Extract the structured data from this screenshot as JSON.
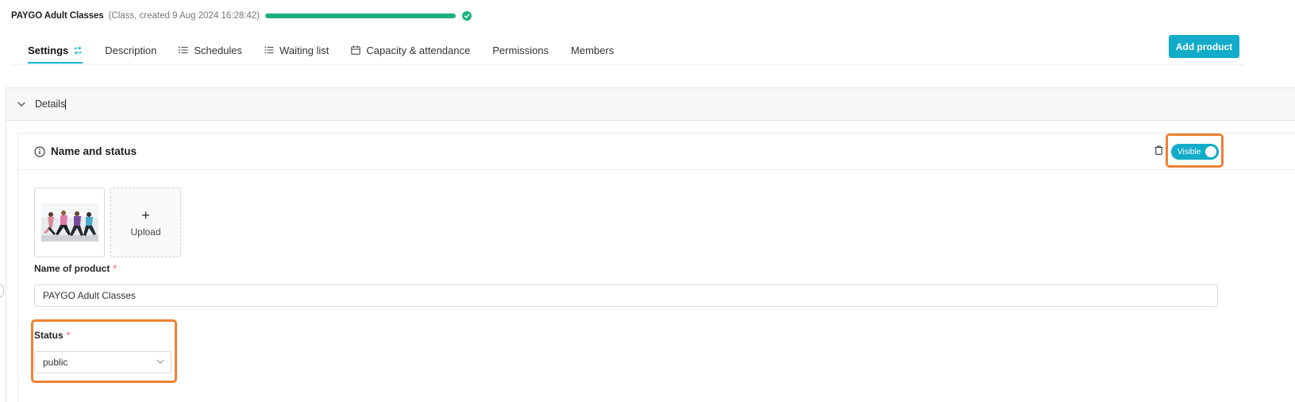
{
  "header": {
    "product_title": "PAYGO Adult Classes",
    "product_meta": "(Class, created 9 Aug 2024 16:28:42)",
    "progress_percent": 100,
    "progress_color": "#19b07e"
  },
  "tabs": [
    {
      "label": "Settings",
      "icon": "sync-icon",
      "active": true
    },
    {
      "label": "Description",
      "icon": "",
      "active": false
    },
    {
      "label": "Schedules",
      "icon": "list-icon",
      "active": false
    },
    {
      "label": "Waiting list",
      "icon": "list-numbered-icon",
      "active": false
    },
    {
      "label": "Capacity & attendance",
      "icon": "calendar-icon",
      "active": false
    },
    {
      "label": "Permissions",
      "icon": "",
      "active": false
    },
    {
      "label": "Members",
      "icon": "",
      "active": false
    }
  ],
  "actions": {
    "add_product_label": "Add product",
    "accent_color": "#12acc9"
  },
  "details": {
    "label": "Details",
    "section_title": "Name and status",
    "visibility_toggle_label": "Visible",
    "visibility_on": true,
    "upload_label": "Upload",
    "name_label": "Name of product",
    "required_mark": "*",
    "name_value": "PAYGO Adult Classes",
    "status_label": "Status",
    "status_value": "public"
  },
  "highlight_color": "#ee8133"
}
